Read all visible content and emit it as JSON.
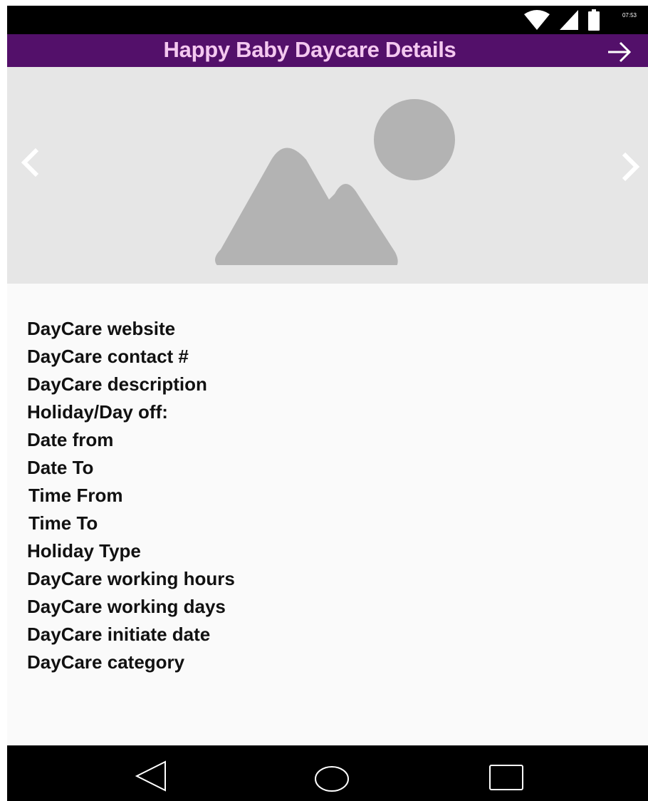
{
  "status_bar": {
    "time": "07:53",
    "icons": [
      "wifi-icon",
      "signal-icon",
      "battery-icon"
    ]
  },
  "app_bar": {
    "title": "Happy Baby Daycare Details",
    "forward_icon": "arrow-right-icon",
    "background": "#53106a",
    "title_color": "#f4c8f0"
  },
  "carousel": {
    "image_icon": "image-placeholder-icon",
    "prev_icon": "chevron-left-icon",
    "next_icon": "chevron-right-icon"
  },
  "details": {
    "lines": [
      "DayCare website",
      "DayCare contact #",
      "DayCare description",
      "Holiday/Day off:",
      "Date from",
      "Date To",
      "Time From",
      "Time To",
      "Holiday Type",
      "DayCare working hours",
      "DayCare working days",
      "DayCare initiate date",
      "DayCare category"
    ]
  },
  "nav_bar": {
    "buttons": [
      "back-triangle-icon",
      "home-circle-icon",
      "recents-square-icon"
    ]
  }
}
